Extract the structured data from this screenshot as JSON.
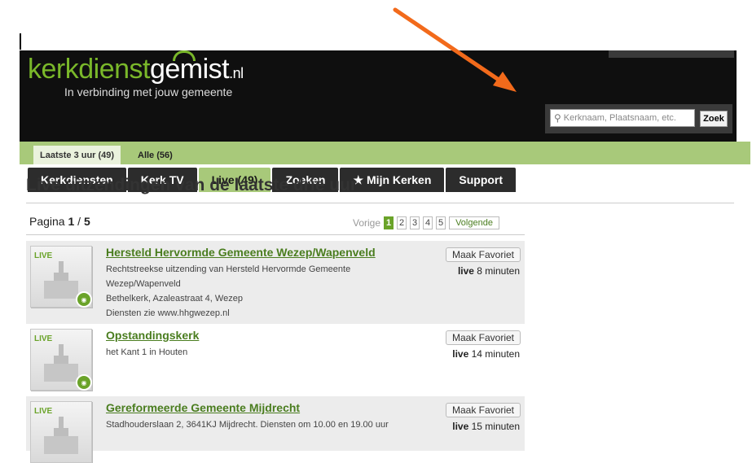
{
  "header": {
    "logo_part1": "kerkdienst",
    "logo_part2": "gemist",
    "logo_tld": ".nl",
    "tagline": "In verbinding met jouw gemeente"
  },
  "nav": {
    "tabs": [
      {
        "label": "Kerkdiensten"
      },
      {
        "label": "Kerk.TV"
      },
      {
        "label": "Live (49)"
      },
      {
        "label": "Zoeken"
      },
      {
        "label": "Mijn Kerken",
        "icon": "★"
      },
      {
        "label": "Support"
      }
    ]
  },
  "search": {
    "placeholder": "Kerknaam, Plaatsnaam, etc.",
    "button_label": "Zoek"
  },
  "subnav": {
    "tabs": [
      {
        "label": "Laatste 3 uur (49)"
      },
      {
        "label": "Alle (56)"
      }
    ]
  },
  "page": {
    "title": "Live uitzendingen van de laatste drie uur",
    "pagina_label": "Pagina",
    "current_page": "1",
    "separator": "/",
    "total_pages": "5"
  },
  "pager": {
    "prev_label": "Vorige",
    "pages": [
      "1",
      "2",
      "3",
      "4",
      "5"
    ],
    "next_label": "Volgende"
  },
  "results": [
    {
      "live_label": "LIVE",
      "title": "Hersteld Hervormde Gemeente Wezep/Wapenveld",
      "description": "Rechtstreekse uitzending van Hersteld Hervormde Gemeente Wezep/Wapenveld",
      "address": "Bethelkerk, Azaleastraat 4, Wezep",
      "extra": "Diensten zie www.hhgwezep.nl",
      "fav_label": "Maak Favoriet",
      "live_word": "live",
      "live_time": "8 minuten"
    },
    {
      "live_label": "LIVE",
      "title": "Opstandingskerk",
      "description": "het Kant 1 in Houten",
      "fav_label": "Maak Favoriet",
      "live_word": "live",
      "live_time": "14 minuten"
    },
    {
      "live_label": "LIVE",
      "title": "Gereformeerde Gemeente Mijdrecht",
      "description": "Stadhouderslaan 2, 3641KJ Mijdrecht. Diensten om 10.00 en 19.00 uur",
      "fav_label": "Maak Favoriet",
      "live_word": "live",
      "live_time": "15 minuten"
    }
  ],
  "colors": {
    "accent_green": "#6aa329",
    "subbar_green": "#a8c97a",
    "header_bg": "#0f0f0f",
    "annotation_arrow": "#f26a1b"
  }
}
